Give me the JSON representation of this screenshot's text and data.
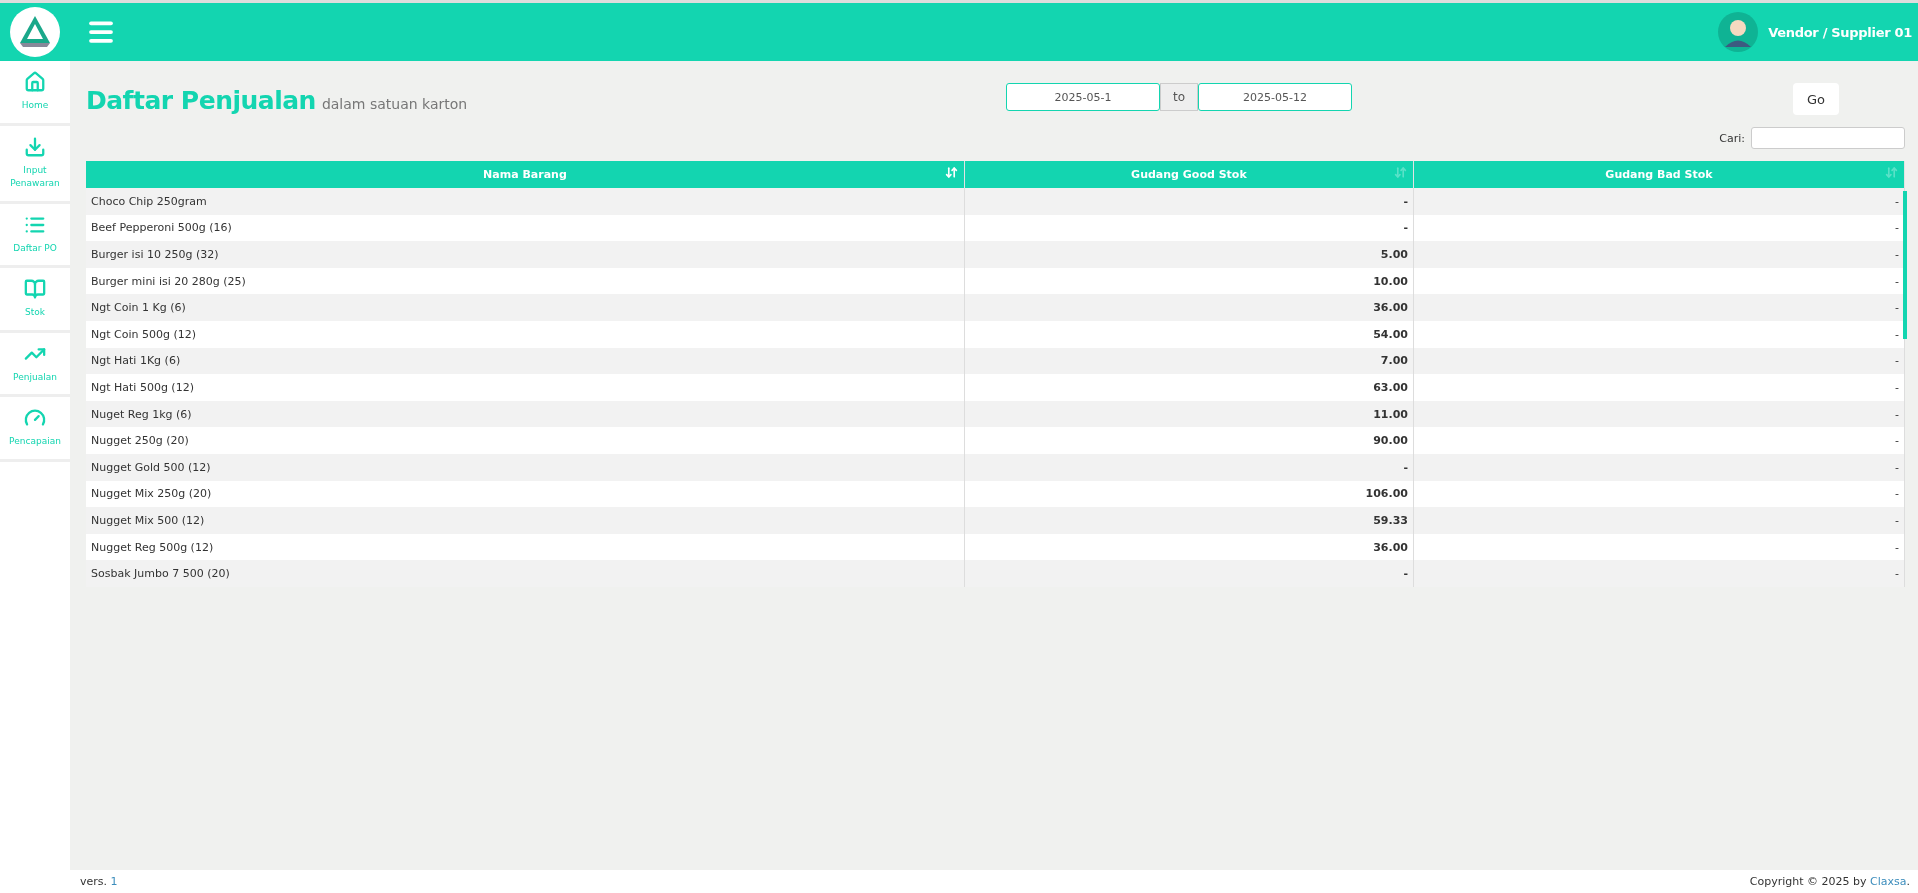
{
  "topbar": {
    "user_name": "Vendor / Supplier 01"
  },
  "sidebar": {
    "items": [
      {
        "kind": "home",
        "label": "Home"
      },
      {
        "kind": "download",
        "label": "Input Penawaran"
      },
      {
        "kind": "list",
        "label": "Daftar PO"
      },
      {
        "kind": "book",
        "label": "Stok"
      },
      {
        "kind": "chart",
        "label": "Penjualan"
      },
      {
        "kind": "gauge",
        "label": "Pencapaian"
      }
    ]
  },
  "page": {
    "title": "Daftar Penjualan",
    "subtitle": "dalam satuan karton"
  },
  "date_range": {
    "from": "2025-05-1",
    "separator": "to",
    "to": "2025-05-12",
    "button": "Go"
  },
  "search": {
    "label": "Cari:"
  },
  "table": {
    "columns": [
      {
        "label": "Nama Barang",
        "sort_active": true
      },
      {
        "label": "Gudang Good Stok",
        "sort_active": false
      },
      {
        "label": "Gudang Bad Stok",
        "sort_active": false
      }
    ],
    "rows": [
      [
        "Choco Chip 250gram",
        "-",
        "-"
      ],
      [
        "Beef Pepperoni 500g (16)",
        "-",
        "-"
      ],
      [
        "Burger isi 10 250g (32)",
        "5.00",
        "-"
      ],
      [
        "Burger mini isi 20 280g (25)",
        "10.00",
        "-"
      ],
      [
        "Ngt Coin 1 Kg (6)",
        "36.00",
        "-"
      ],
      [
        "Ngt Coin 500g (12)",
        "54.00",
        "-"
      ],
      [
        "Ngt Hati 1Kg (6)",
        "7.00",
        "-"
      ],
      [
        "Ngt Hati 500g (12)",
        "63.00",
        "-"
      ],
      [
        "Nuget Reg 1kg (6)",
        "11.00",
        "-"
      ],
      [
        "Nugget 250g (20)",
        "90.00",
        "-"
      ],
      [
        "Nugget Gold 500 (12)",
        "-",
        "-"
      ],
      [
        "Nugget Mix 250g (20)",
        "106.00",
        "-"
      ],
      [
        "Nugget Mix 500 (12)",
        "59.33",
        "-"
      ],
      [
        "Nugget Reg 500g (12)",
        "36.00",
        "-"
      ],
      [
        "Sosbak Jumbo 7 500 (20)",
        "-",
        "-"
      ]
    ]
  },
  "footer": {
    "version_label": "vers.",
    "version": "1",
    "copyright": "Copyright © 2025 by",
    "company": "Claxsa",
    "end": "."
  }
}
